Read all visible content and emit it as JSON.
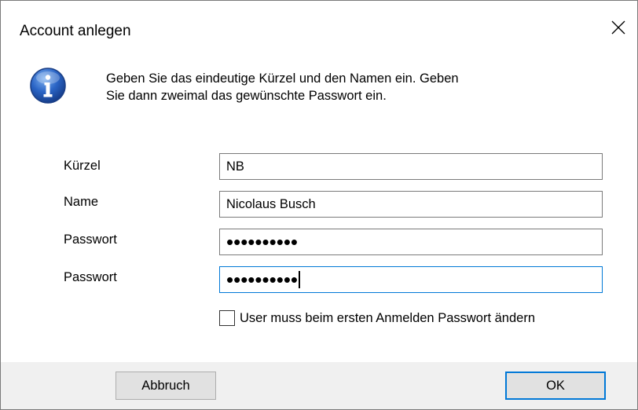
{
  "window": {
    "title": "Account anlegen",
    "close_icon": "close-icon"
  },
  "message": {
    "icon": "info-icon",
    "line1": "Geben Sie das eindeutige Kürzel und den Namen ein. Geben",
    "line2": "Sie dann zweimal das gewünschte Passwort ein."
  },
  "form": {
    "kuerzel": {
      "label": "Kürzel",
      "value": "NB"
    },
    "name": {
      "label": "Name",
      "value": "Nicolaus Busch"
    },
    "password1": {
      "label": "Passwort",
      "masked": "••••••••••"
    },
    "password2": {
      "label": "Passwort",
      "masked": "••••••••••"
    },
    "change_pw_checkbox": {
      "label": "User muss beim ersten Anmelden Passwort ändern",
      "checked": false
    }
  },
  "buttons": {
    "cancel": "Abbruch",
    "ok": "OK"
  },
  "colors": {
    "accent": "#0078d7",
    "dialog_bg": "#f0f0f0",
    "button_bg": "#e1e1e1"
  }
}
